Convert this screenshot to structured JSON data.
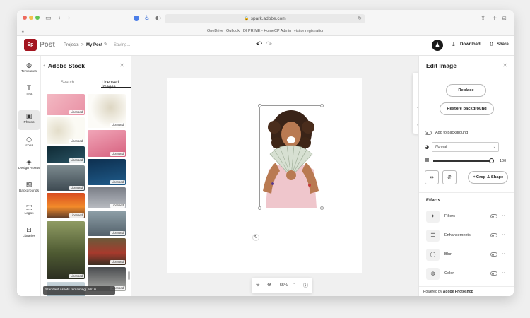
{
  "browser": {
    "url": "spark.adobe.com",
    "bookmarks": [
      "OneDrive",
      "Outlook",
      "DI PRIME - Home",
      "CP Admin",
      "visitor registration"
    ]
  },
  "header": {
    "logo_letters": "Sp",
    "app_name": "Post",
    "breadcrumb_projects": "Projects",
    "breadcrumb_separator": ">",
    "breadcrumb_current": "My Post",
    "saving_status": "Saving...",
    "download_label": "Download",
    "share_label": "Share"
  },
  "rail": {
    "items": [
      {
        "label": "Templates",
        "icon": "templates-icon"
      },
      {
        "label": "Text",
        "icon": "text-icon"
      },
      {
        "label": "Photos",
        "icon": "photos-icon"
      },
      {
        "label": "Icons",
        "icon": "icons-icon"
      },
      {
        "label": "Design Assets",
        "icon": "design-assets-icon"
      },
      {
        "label": "Backgrounds",
        "icon": "backgrounds-icon"
      },
      {
        "label": "Logos",
        "icon": "logos-icon"
      },
      {
        "label": "Libraries",
        "icon": "libraries-icon"
      }
    ],
    "active": "Photos"
  },
  "stock": {
    "title": "Adobe Stock",
    "tabs": [
      "Search",
      "Licensed Images"
    ],
    "active_tab": "Licensed Images",
    "badge": "Licensed",
    "toast": "Standard assets remaining: 10/10"
  },
  "canvas": {
    "zoom": "55%"
  },
  "edit_panel": {
    "title": "Edit Image",
    "replace_label": "Replace",
    "restore_label": "Restore background",
    "add_to_background_label": "Add to background",
    "blend_mode": "Normal",
    "opacity": "100",
    "crop_label": "Crop & Shape",
    "effects_heading": "Effects",
    "effects": [
      "Filters",
      "Enhancements",
      "Blur",
      "Color"
    ],
    "footer_prefix": "Powered by",
    "footer_brand": "Adobe Photoshop"
  },
  "colors": {
    "brand": "#a3141f",
    "canvas_bg": "#f0f0f0"
  }
}
